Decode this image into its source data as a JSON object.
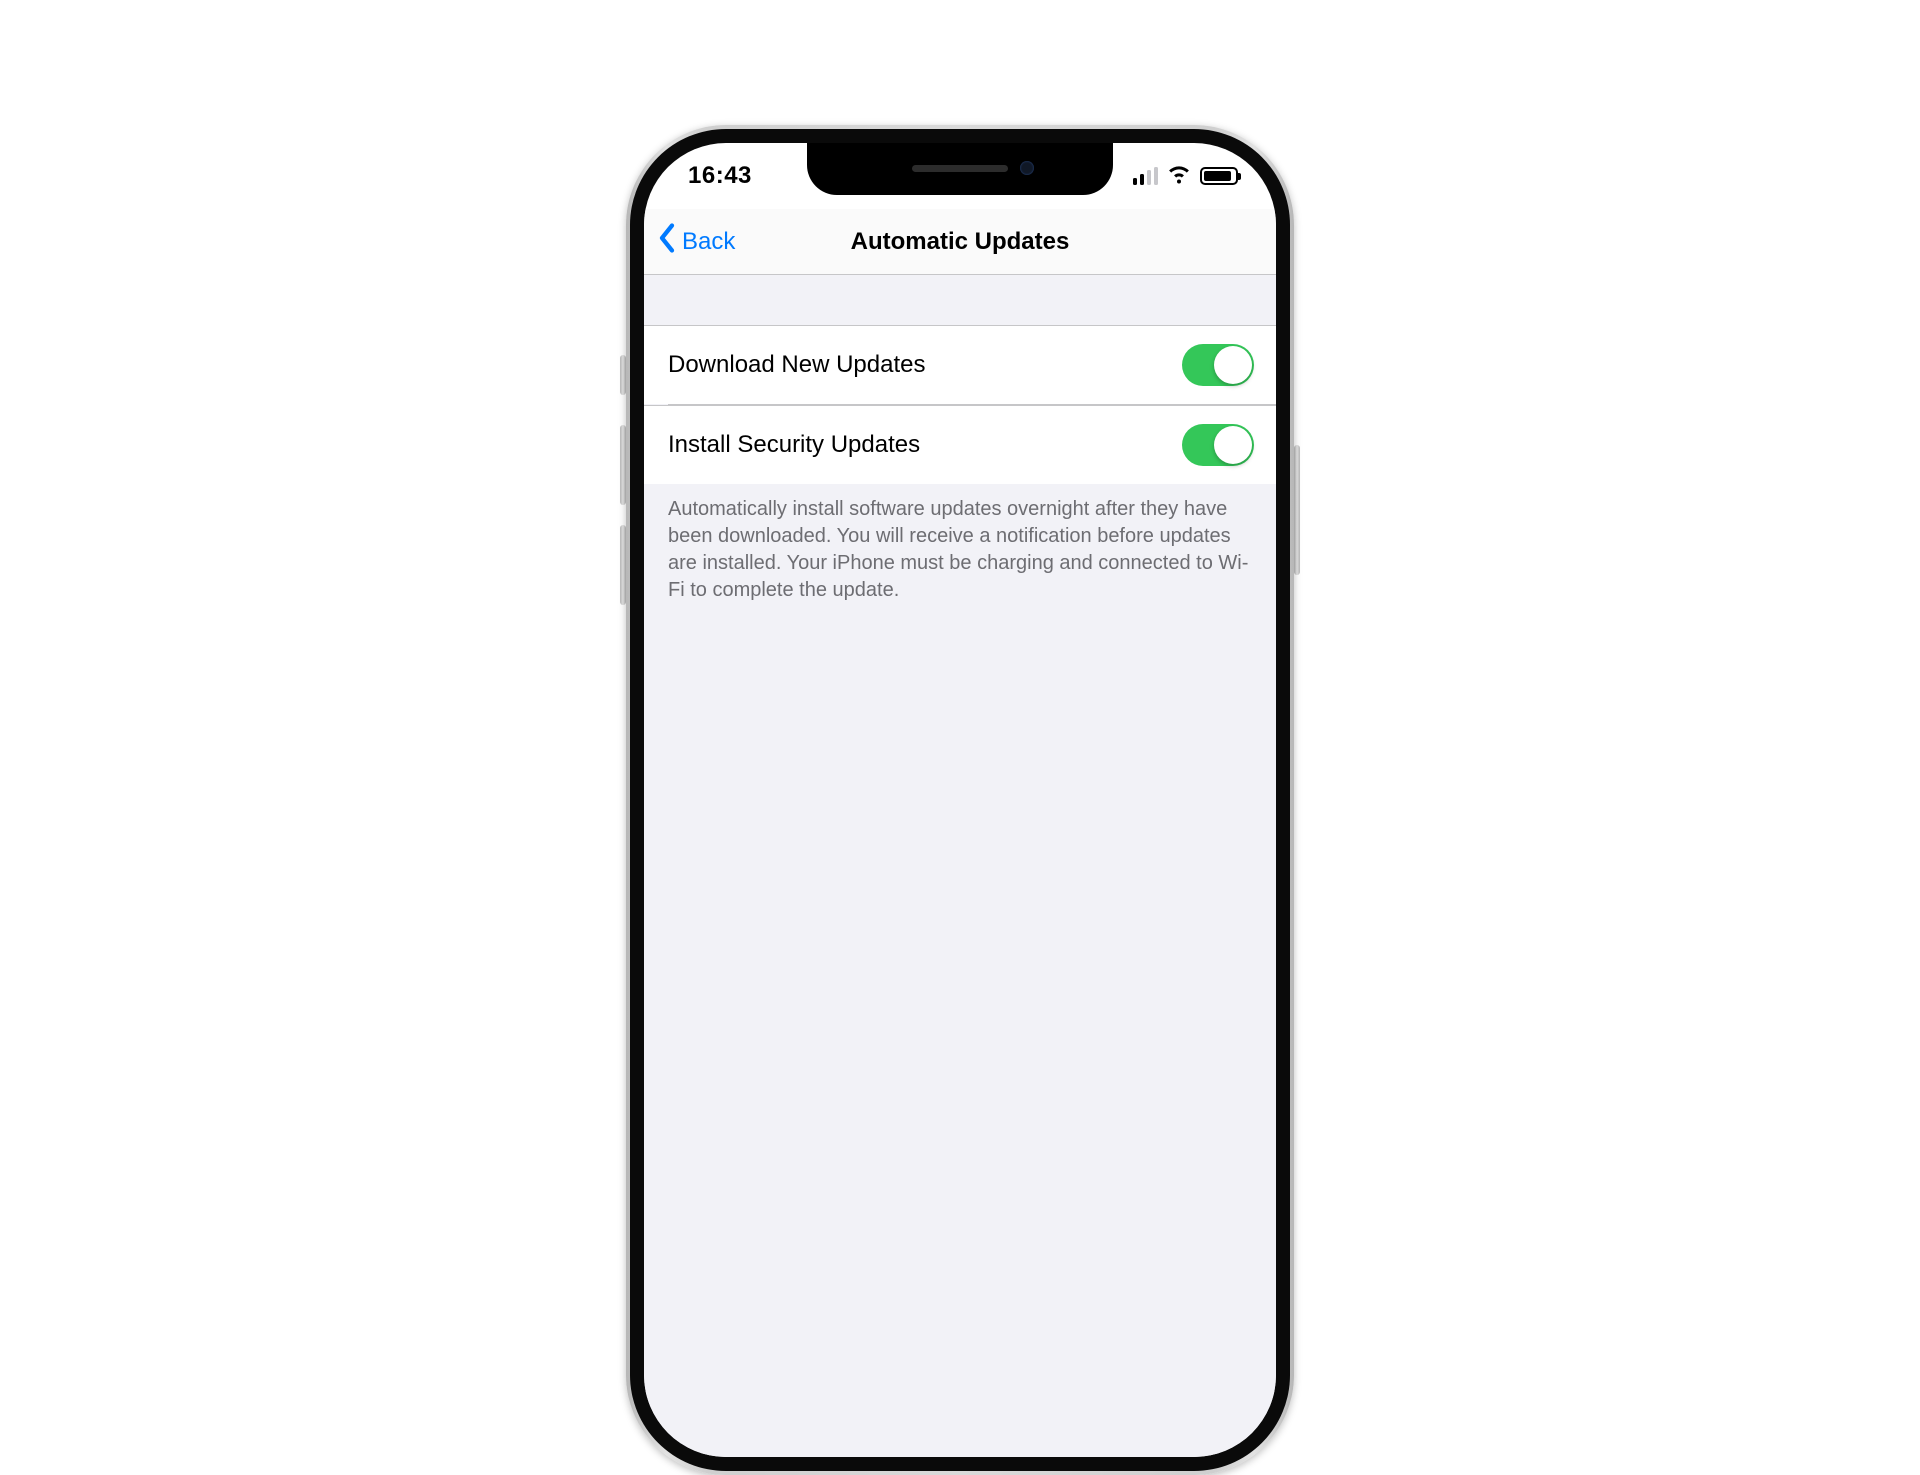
{
  "status": {
    "time": "16:43",
    "signal_active_bars": 2,
    "signal_total_bars": 4
  },
  "nav": {
    "back_label": "Back",
    "title": "Automatic Updates"
  },
  "rows": [
    {
      "label": "Download New Updates",
      "on": true
    },
    {
      "label": "Install Security Updates",
      "on": true
    }
  ],
  "footer": "Automatically install software updates overnight after they have been downloaded. You will receive a notification before updates are installed. Your iPhone must be charging and connected to Wi-Fi to complete the update.",
  "colors": {
    "accent_blue": "#007aff",
    "switch_green": "#34c759",
    "page_bg": "#f2f2f7"
  }
}
